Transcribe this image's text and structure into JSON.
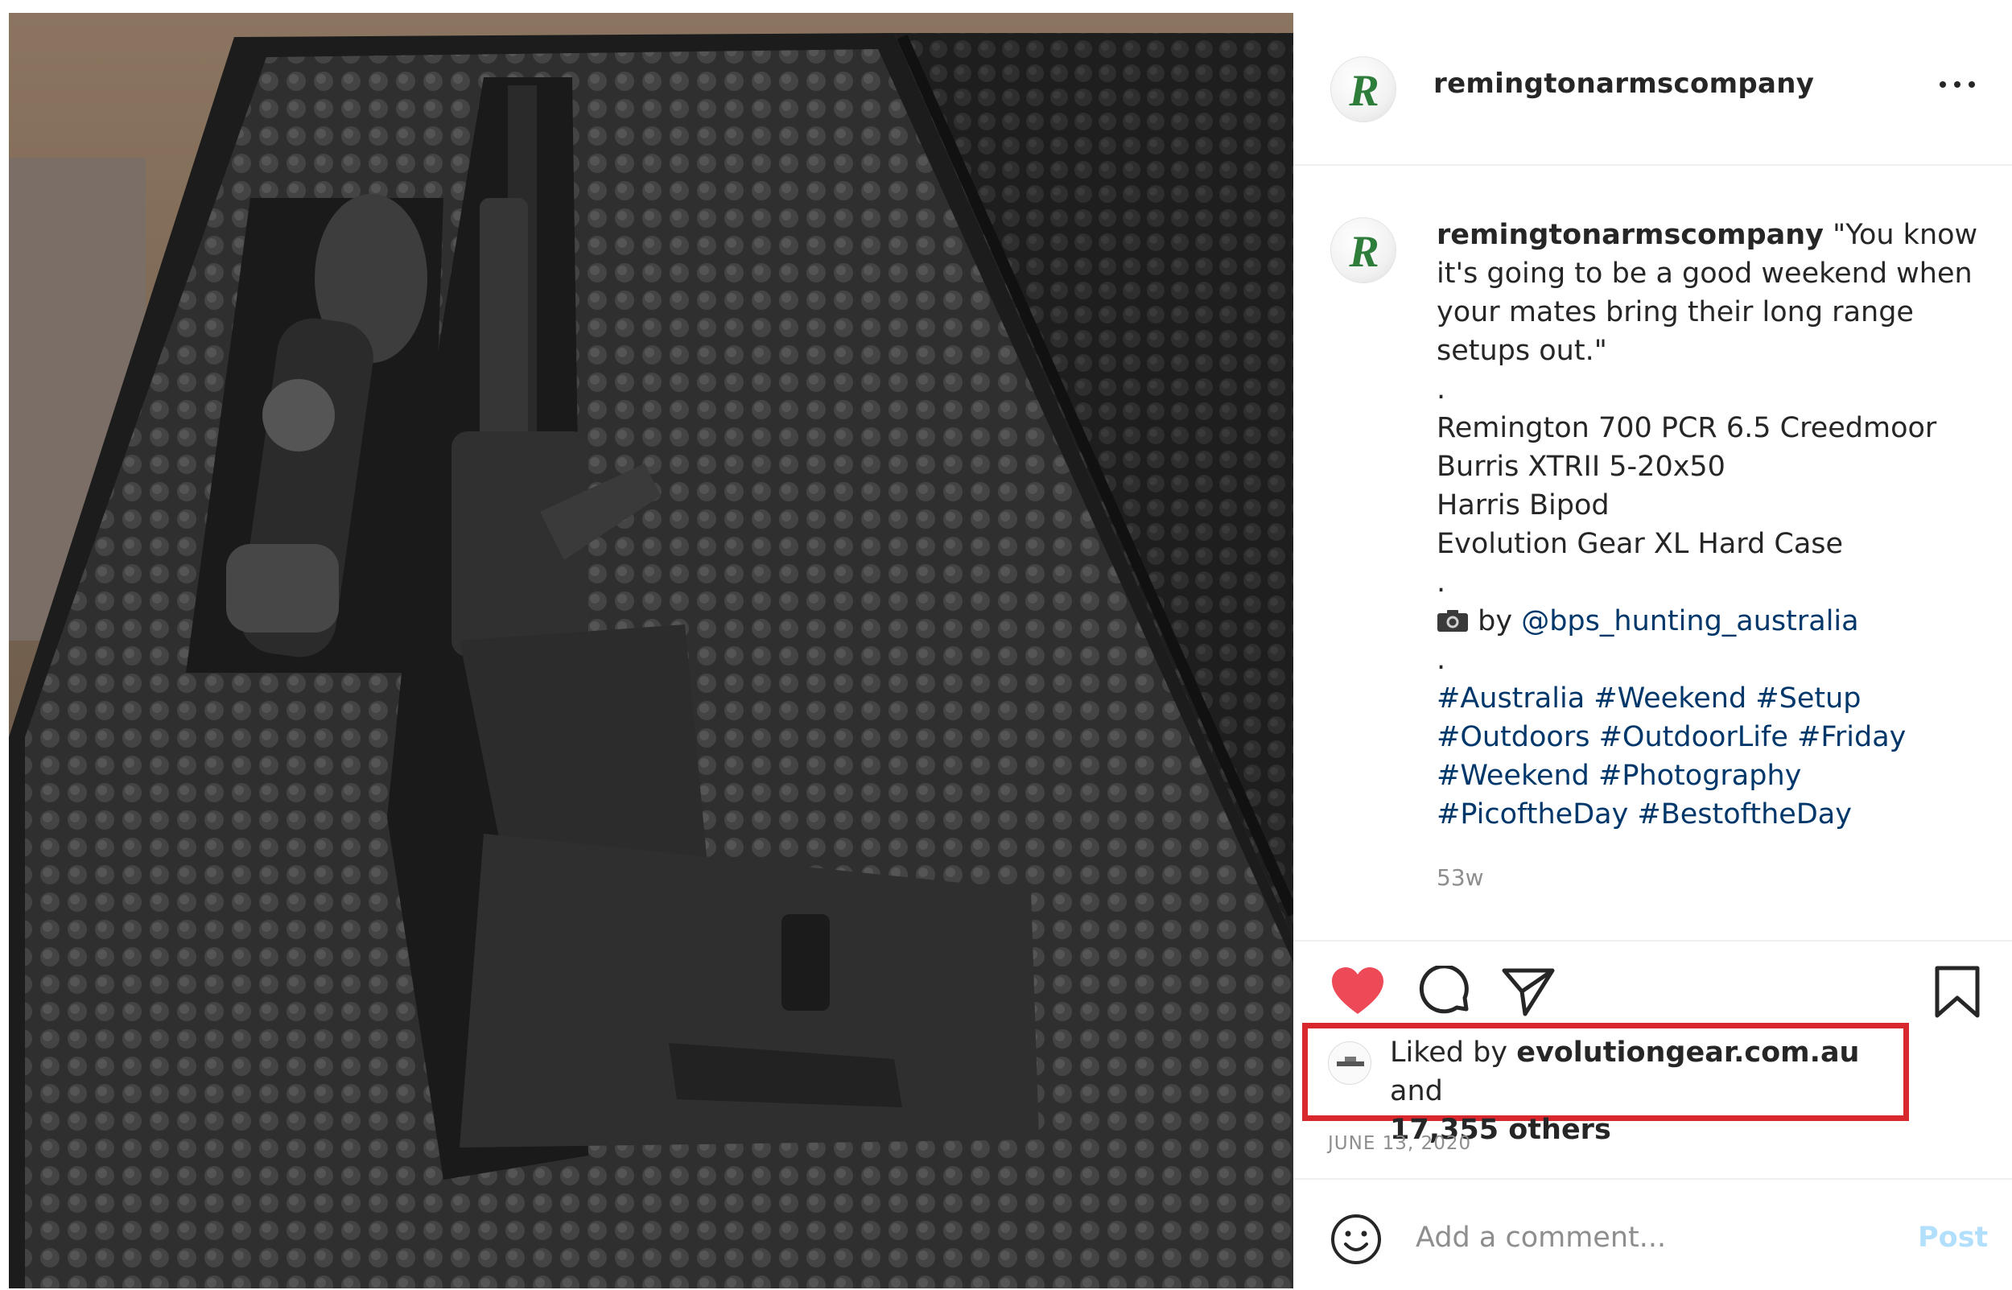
{
  "post": {
    "username": "remingtonarmscompany",
    "avatar_icon": "remington-r-logo-icon",
    "avatar_letter": "R",
    "more_icon": "more-options-icon",
    "caption": {
      "username": "remingtonarmscompany",
      "lines": [
        "\"You know",
        "it's going to be a good weekend when",
        "your mates bring their long range",
        "setups out.\"",
        ".",
        "Remington 700 PCR 6.5 Creedmoor",
        "Burris XTRII 5-20x50",
        "Harris Bipod",
        "Evolution Gear XL Hard Case",
        "."
      ],
      "photo_credit_icon": "camera-icon",
      "photo_credit_prefix": "by",
      "photo_credit_handle": "@bps_hunting_australia",
      "dot": ".",
      "hashtag_lines": [
        "#Australia #Weekend #Setup",
        "#Outdoors #OutdoorLife #Friday",
        "#Weekend #Photography",
        "#PicoftheDay #BestoftheDay"
      ]
    },
    "time_ago": "53w",
    "actions": {
      "like_icon": "heart-filled-icon",
      "comment_icon": "comment-icon",
      "share_icon": "share-icon",
      "save_icon": "bookmark-icon",
      "like_color": "#ed4956"
    },
    "likes": {
      "prefix": "Liked by",
      "user": "evolutiongear.com.au",
      "conjunction": "and",
      "others": "17,355 others",
      "highlight_color": "#d9272e"
    },
    "date": "JUNE 13, 2020",
    "comment": {
      "emoji_icon": "smiley-icon",
      "placeholder": "Add a comment...",
      "post_label": "Post"
    }
  },
  "colors": {
    "link": "#00376b",
    "secondary": "#8e8e8e",
    "post_disabled": "#b2dffc",
    "brand_green": "#2e7d3a"
  }
}
